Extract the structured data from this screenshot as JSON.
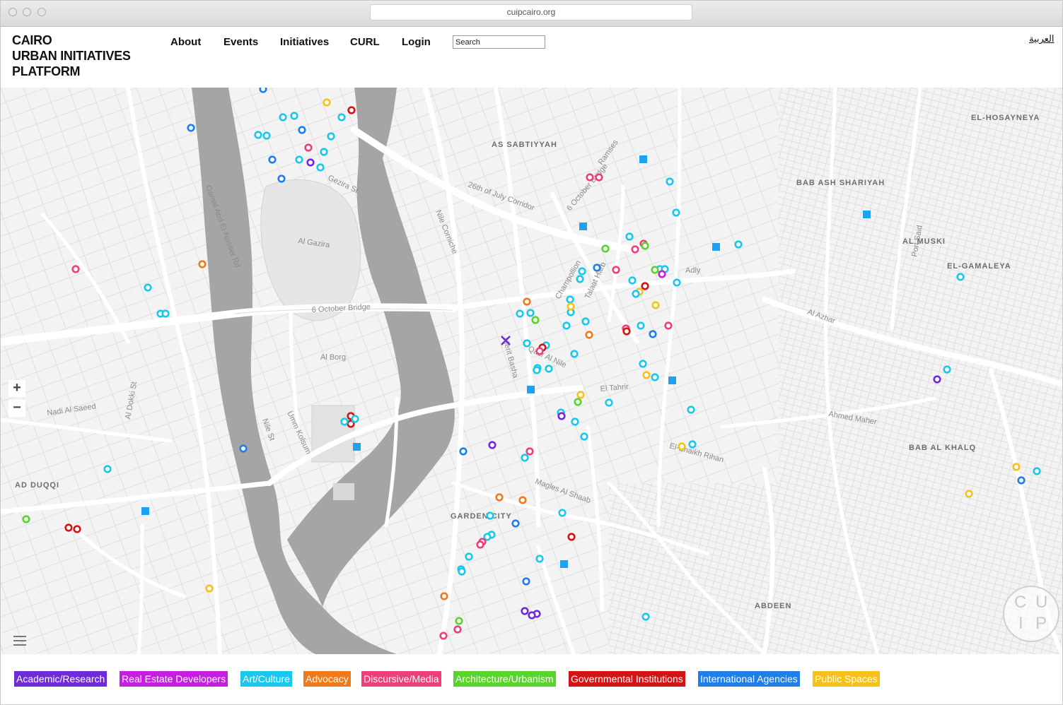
{
  "browser": {
    "url": "cuipcairo.org"
  },
  "site": {
    "logo_lines": [
      "CAIRO",
      "URBAN INITIATIVES",
      "PLATFORM"
    ]
  },
  "nav": {
    "about": "About",
    "events": "Events",
    "initiatives": "Initiatives",
    "curl": "CURL",
    "login": "Login",
    "search_placeholder": "Search",
    "language": "العربية"
  },
  "map": {
    "zoom_in": "+",
    "zoom_out": "−",
    "badge_letters": [
      "C",
      "U",
      "I",
      "P"
    ],
    "districts": [
      "AS SABTIYYAH",
      "EL-HOSAYNEYA",
      "BAB ASH SHARIYAH",
      "AL MUSKI",
      "EL-GAMALEYA",
      "BAB AL KHALQ",
      "ABDEEN",
      "AD DUQQI",
      "GARDEN CITY"
    ],
    "streets": [
      "26th of July Corridor",
      "6 October Bridge",
      "Gezira St",
      "Nile Corniche",
      "Al Gazira",
      "Al Borg",
      "El Tahrir",
      "Qasr Al Nile",
      "Talaat Harb",
      "Ramses",
      "Adly",
      "Al Azhar",
      "Gamal Abd El-Nasser Rd",
      "Nadi Al Saeed",
      "Magles Al Shaab",
      "Port Said",
      "El-Shaikh Rihan",
      "Ahmed Maher",
      "Umm Kolsum",
      "Nile St",
      "Al Dokki St",
      "Merit Basha",
      "Champollion"
    ]
  },
  "legend": [
    {
      "label": "Academic/Research",
      "color": "#6f2bd8"
    },
    {
      "label": "Real Estate Developers",
      "color": "#c61ee0"
    },
    {
      "label": "Art/Culture",
      "color": "#19c8ec"
    },
    {
      "label": "Advocacy",
      "color": "#f07a19"
    },
    {
      "label": "Discursive/Media",
      "color": "#ee3f79"
    },
    {
      "label": "Architecture/Urbanism",
      "color": "#58d42a"
    },
    {
      "label": "Governmental Institutions",
      "color": "#d41414"
    },
    {
      "label": "International Agencies",
      "color": "#1f7ee8"
    },
    {
      "label": "Public Spaces",
      "color": "#f6c21a"
    }
  ]
}
